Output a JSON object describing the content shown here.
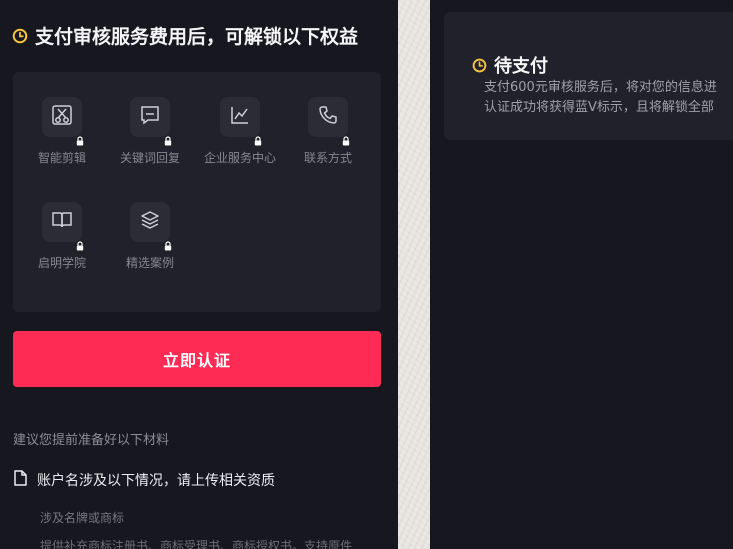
{
  "left": {
    "header": {
      "title": "支付审核服务费用后，可解锁以下权益"
    },
    "benefits": [
      {
        "label": "智能剪辑",
        "icon": "scissors-icon"
      },
      {
        "label": "关键词回复",
        "icon": "chat-icon"
      },
      {
        "label": "企业服务中心",
        "icon": "chart-icon"
      },
      {
        "label": "联系方式",
        "icon": "phone-icon"
      },
      {
        "label": "启明学院",
        "icon": "book-icon"
      },
      {
        "label": "精选案例",
        "icon": "layers-icon"
      }
    ],
    "cta_label": "立即认证",
    "advice": "建议您提前准备好以下材料",
    "materials": {
      "title": "账户名涉及以下情况，请上传相关资质",
      "sub1": "涉及名牌或商标",
      "sub2": "提供补充商标注册书、商标受理书、商标授权书。支持原件"
    }
  },
  "right": {
    "status_title": "待支付",
    "line1": "支付600元审核服务后，将对您的信息进",
    "line2": "认证成功将获得蓝V标示，且将解锁全部"
  },
  "colors": {
    "accent": "#fe2c55",
    "clock": "#f7c441",
    "panel_bg": "#17171f",
    "card_bg": "#21212b"
  }
}
